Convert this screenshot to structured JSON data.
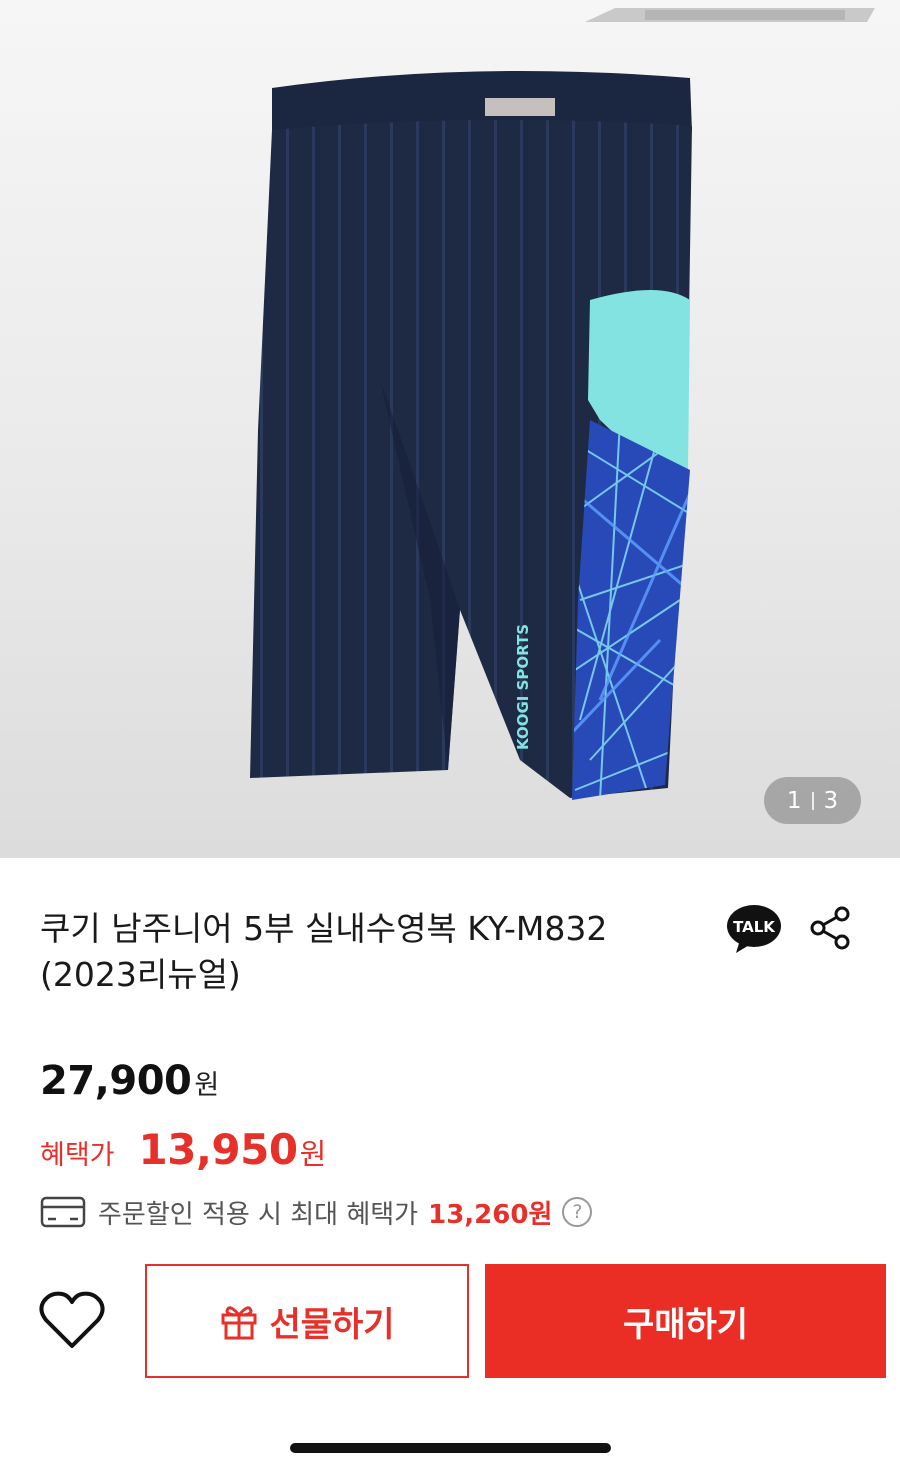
{
  "gallery": {
    "current": "1",
    "total": "3",
    "product_print": "KOOGI SPORTS"
  },
  "product": {
    "title_line1": "쿠기 남주니어 5부 실내수영복 KY-M832",
    "title_line2": "(2023리뉴얼)"
  },
  "icons": {
    "talk": "kakao-talk-icon",
    "talk_text": "TALK",
    "share": "share-icon",
    "card": "card-icon",
    "help": "help-icon",
    "help_text": "?",
    "heart": "heart-icon",
    "gift": "gift-icon"
  },
  "price": {
    "original": "27,900",
    "currency": "원",
    "benefit_label": "혜택가",
    "benefit": "13,950",
    "max_text": "주문할인 적용 시 최대 혜택가",
    "max_amount": "13,260원"
  },
  "actions": {
    "gift_label": "선물하기",
    "buy_label": "구매하기"
  },
  "colors": {
    "accent": "#ea2e26",
    "navy": "#1e2a44",
    "aqua": "#7fe3e1",
    "royal": "#3a5fd6"
  }
}
